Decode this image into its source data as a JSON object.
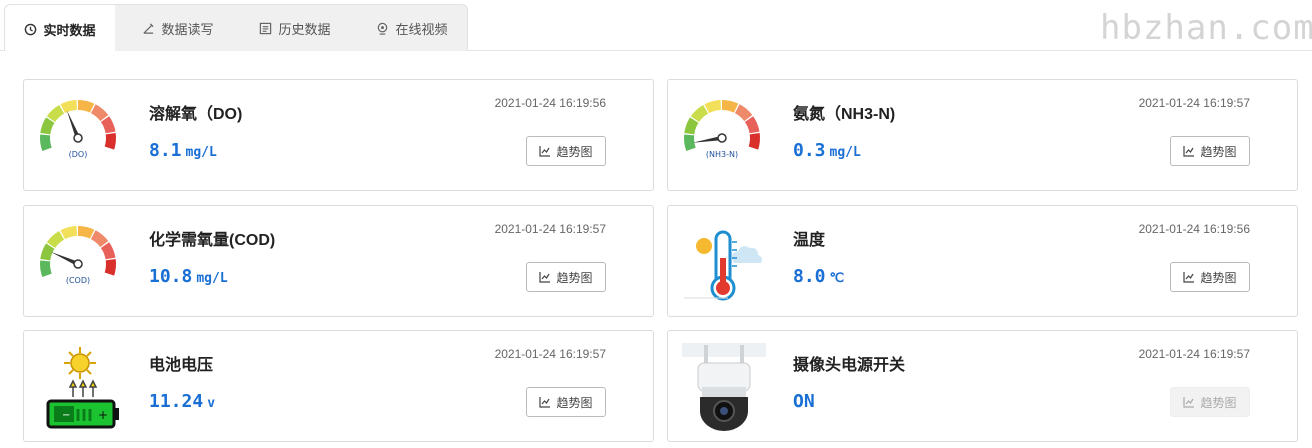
{
  "tabs": [
    {
      "label": "实时数据",
      "icon": "clock-icon",
      "active": true
    },
    {
      "label": "数据读写",
      "icon": "pen-icon",
      "active": false
    },
    {
      "label": "历史数据",
      "icon": "list-icon",
      "active": false
    },
    {
      "label": "在线视频",
      "icon": "camera-icon",
      "active": false
    }
  ],
  "watermark": "hbzhan.com",
  "trend_label": "趋势图",
  "cards": [
    {
      "name": "溶解氧（DO)",
      "value": "8.1",
      "unit": "mg/L",
      "time": "2021-01-24 16:19:56",
      "icon": "gauge-icon",
      "gauge_label": "(DO)",
      "gauge_fraction": 0.4,
      "trend_enabled": true
    },
    {
      "name": "氨氮（NH3-N)",
      "value": "0.3",
      "unit": "mg/L",
      "time": "2021-01-24 16:19:57",
      "icon": "gauge-icon",
      "gauge_label": "(NH3-N)",
      "gauge_fraction": 0.05,
      "trend_enabled": true
    },
    {
      "name": "化学需氧量(COD)",
      "value": "10.8",
      "unit": "mg/L",
      "time": "2021-01-24 16:19:57",
      "icon": "gauge-icon",
      "gauge_label": "(COD)",
      "gauge_fraction": 0.2,
      "trend_enabled": true
    },
    {
      "name": "温度",
      "value": "8.0",
      "unit": "℃",
      "time": "2021-01-24 16:19:56",
      "icon": "thermometer-icon",
      "trend_enabled": true
    },
    {
      "name": "电池电压",
      "value": "11.24",
      "unit": "v",
      "time": "2021-01-24 16:19:57",
      "icon": "solar-battery-icon",
      "trend_enabled": true
    },
    {
      "name": "摄像头电源开关",
      "value": "ON",
      "unit": "",
      "time": "2021-01-24 16:19:57",
      "icon": "camera-device-icon",
      "trend_enabled": false
    }
  ],
  "colors": {
    "accent": "#1a6fd4",
    "gauge": [
      "#5cb85c",
      "#8cc63f",
      "#c9dd4a",
      "#f2e05a",
      "#f5b547",
      "#ee8a6a",
      "#e8605a",
      "#d9302c"
    ]
  }
}
